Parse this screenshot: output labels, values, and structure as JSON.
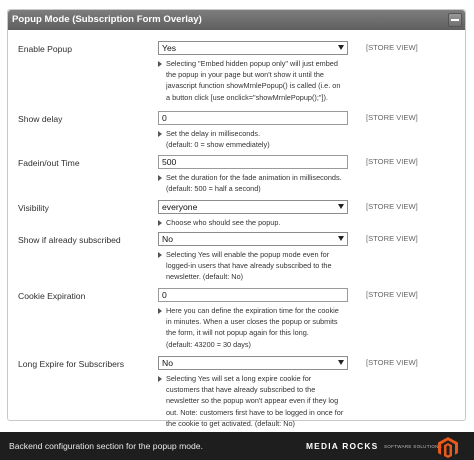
{
  "section": {
    "title": "Popup Mode (Subscription Form Overlay)"
  },
  "rows": {
    "enable_popup": {
      "label": "Enable Popup",
      "value": "Yes",
      "scope": "[STORE VIEW]",
      "note": [
        "Selecting \"Embed hidden popup only\" will just embed",
        "the popup in your page but won't show it until the",
        "javascript function showMrnlePopup() is called (i.e. on",
        "a button click [use onclick=\"showMrnlePopup();\"])."
      ]
    },
    "show_delay": {
      "label": "Show delay",
      "value": "0",
      "scope": "[STORE VIEW]",
      "note": [
        "Set the delay in milliseconds.",
        "(default: 0 = show emmediately)"
      ]
    },
    "fadein_out": {
      "label": "Fadein/out Time",
      "value": "500",
      "scope": "[STORE VIEW]",
      "note": [
        "Set the duration for the fade animation in milliseconds.",
        "(default: 500 = half a second)"
      ]
    },
    "visibility": {
      "label": "Visibility",
      "value": "everyone",
      "scope": "[STORE VIEW]",
      "note": [
        "Choose who should see the popup."
      ]
    },
    "already_subscribed": {
      "label": "Show if already subscribed",
      "value": "No",
      "scope": "[STORE VIEW]",
      "note": [
        "Selecting Yes will enable the popup mode even for",
        "logged-in users that have already subscribed to the",
        "newsletter. (default: No)"
      ]
    },
    "cookie_expiration": {
      "label": "Cookie Expiration",
      "value": "0",
      "scope": "[STORE VIEW]",
      "note": [
        "Here you can define the expiration time for the cookie",
        "in minutes. When a user closes the popup or submits",
        "the form, it will not popup again for this long.",
        "(default: 43200 = 30 days)"
      ]
    },
    "long_expire": {
      "label": "Long Expire for Subscribers",
      "value": "No",
      "scope": "[STORE VIEW]",
      "note": [
        "Selecting Yes will set a long expire cookie for",
        "customers that have already subscribed to the",
        "newsletter so the popup won't appear even if they log",
        "out. Note: customers first have to be logged in once for",
        "the cookie to get activated. (default: No)"
      ]
    }
  },
  "footer": {
    "text": "Backend configuration section for the popup mode.",
    "brand": "MEDIA ROCKS",
    "brand_sub": "SOFTWARE SOLUTIONS"
  },
  "colors": {
    "header": "#6a6a6a",
    "footer": "#1e1e1e",
    "logo": "#e8591c"
  }
}
